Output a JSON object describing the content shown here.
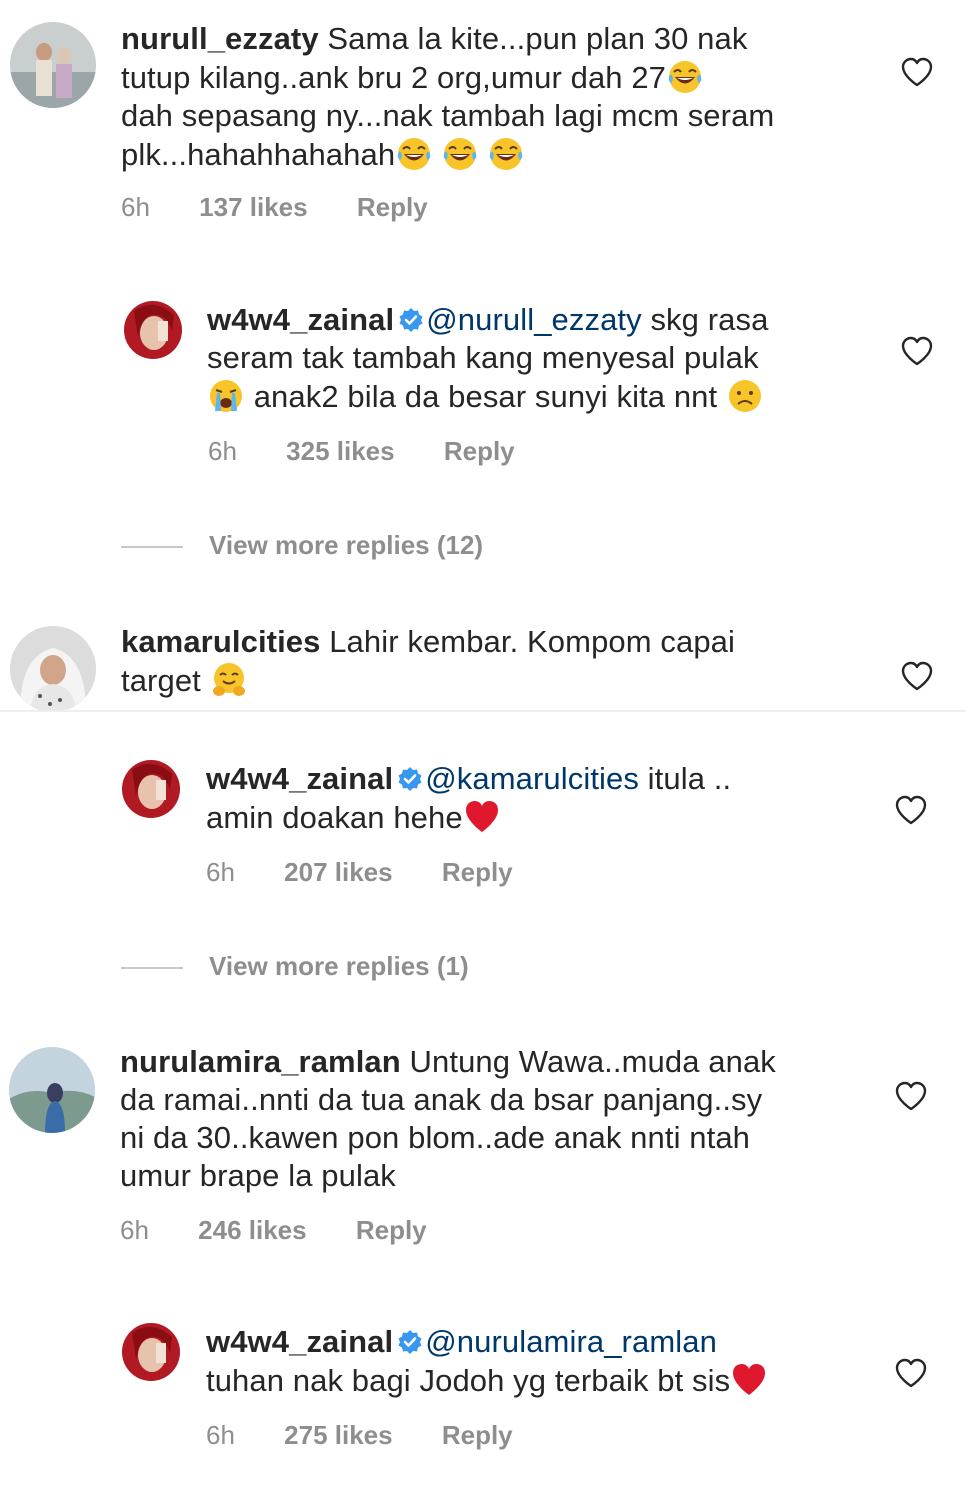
{
  "comments": [
    {
      "username": "nurull_ezzaty",
      "text_l1": "Sama la kite...pun plan 30 nak",
      "text_l2": "tutup kilang..ank bru 2 org,umur dah 27",
      "text_l3": "dah sepasang ny...nak tambah lagi mcm seram",
      "text_l4": "plk...hahahhahahah",
      "time": "6h",
      "likes": "137 likes",
      "reply": "Reply"
    },
    {
      "username": "w4w4_zainal",
      "mention": "@nurull_ezzaty",
      "text_l1": " skg rasa",
      "text_l2": "seram tak tambah kang menyesal pulak",
      "text_l3": " anak2 bila da besar sunyi kita nnt ",
      "time": "6h",
      "likes": "325 likes",
      "reply": "Reply"
    },
    {
      "more": "View more replies (12)"
    },
    {
      "username": "kamarulcities",
      "text_l1": "Lahir kembar. Kompom capai",
      "text_l2": "target "
    },
    {
      "username": "w4w4_zainal",
      "mention": "@kamarulcities",
      "text_l1": " itula ..",
      "text_l2": "amin doakan hehe",
      "time": "6h",
      "likes": "207 likes",
      "reply": "Reply"
    },
    {
      "more": "View more replies (1)"
    },
    {
      "username": "nurulamira_ramlan",
      "text_l1": "Untung Wawa..muda anak",
      "text_l2": "da ramai..nnti da tua anak da bsar panjang..sy",
      "text_l3": "ni da 30..kawen pon blom..ade anak nnti ntah",
      "text_l4": "umur brape la pulak",
      "time": "6h",
      "likes": "246 likes",
      "reply": "Reply"
    },
    {
      "username": "w4w4_zainal",
      "mention": "@nurulamira_ramlan",
      "text_l2": "tuhan nak bagi Jodoh yg terbaik bt sis",
      "time": "6h",
      "likes": "275 likes",
      "reply": "Reply"
    }
  ],
  "icons": {
    "heart": "heart-outline-icon",
    "verified": "verified-badge-icon",
    "emoji_laugh": "face-with-tears-of-joy",
    "emoji_cry": "loudly-crying-face",
    "emoji_sad": "frowning-face",
    "emoji_hug": "hugging-face",
    "emoji_heart": "red-heart"
  },
  "colors": {
    "text": "#262626",
    "meta": "#8e8e8e",
    "mention": "#00376b",
    "verified": "#3897f0",
    "heart_red": "#e0182d"
  }
}
